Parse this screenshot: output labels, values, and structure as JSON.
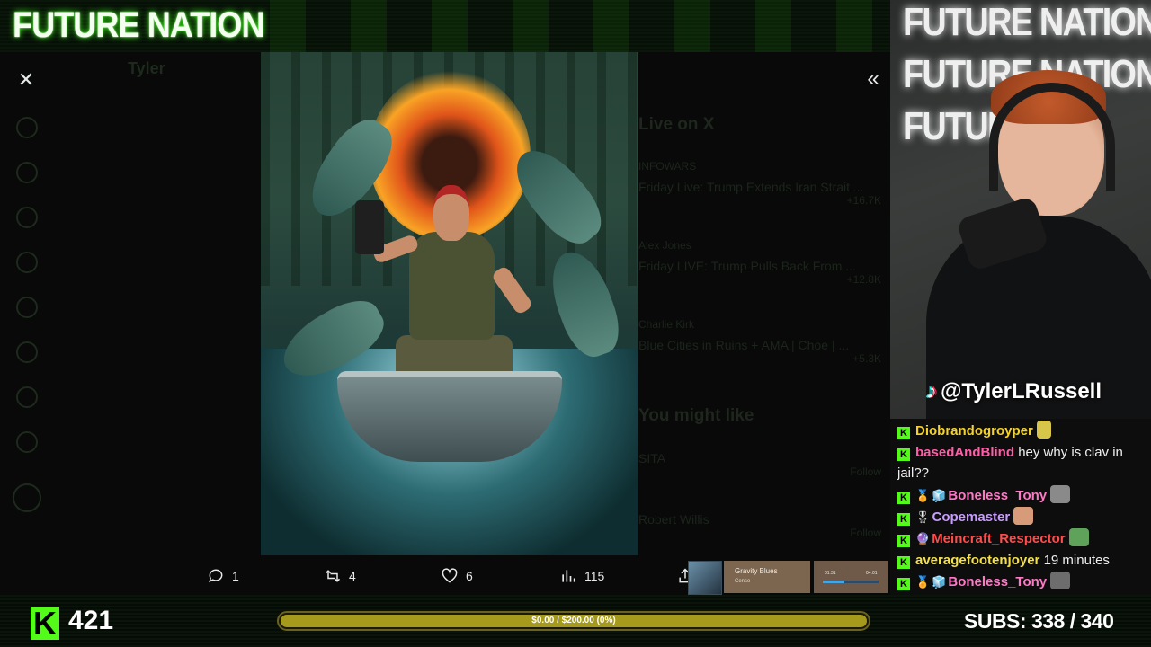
{
  "brand": {
    "title": "FUTURE NATION"
  },
  "viewer": {
    "dim_header": "Tyler",
    "dim_right_title": "Live on X",
    "dim_live_rows": [
      {
        "author": "INFOWARS",
        "title": "Friday Live: Trump Extends Iran Strait ...",
        "count": "+16.7K"
      },
      {
        "author": "Alex Jones",
        "title": "Friday LIVE: Trump Pulls Back From ...",
        "count": "+12.8K"
      },
      {
        "author": "Charlie Kirk",
        "title": "Blue Cities in Ruins + AMA | Choe | ...",
        "count": "+5.3K"
      }
    ],
    "dim_might_like": "You might like",
    "dim_suggestions": [
      {
        "name": "SITA",
        "action": "Follow"
      },
      {
        "name": "Robert Willis",
        "action": "Follow"
      }
    ],
    "actions": {
      "replies": "1",
      "reposts": "4",
      "likes": "6",
      "views": "115"
    }
  },
  "music": {
    "title": "Gravity Blues",
    "artist": "Cense",
    "time_elapsed": "01:31",
    "time_total": "04:01",
    "progress": 0.38
  },
  "cam": {
    "overlay_lines": [
      "FUTURE NATION",
      "FUTURE NATION",
      "FUTURE"
    ],
    "handle": "@TylerLRussell"
  },
  "chat": {
    "messages": [
      {
        "user": "Diobrandogroyper",
        "color": "#f5d22b",
        "text": ""
      },
      {
        "user": "basedAndBlind",
        "color": "#ff5fa8",
        "text": "hey why is clav in jail??"
      },
      {
        "user": "Boneless_Tony",
        "color": "#ff79c6",
        "text": ""
      },
      {
        "user": "Copemaster",
        "color": "#c89bff",
        "text": ""
      },
      {
        "user": "Meincraft_Respector",
        "color": "#ff4d4d",
        "text": ""
      },
      {
        "user": "averagefootenjoyer",
        "color": "#f5e04a",
        "text": "19 minutes"
      },
      {
        "user": "Boneless_Tony",
        "color": "#ff79c6",
        "text": ""
      }
    ]
  },
  "bottom": {
    "viewer_count": "421",
    "goal_text": "$0.00 / $200.00 (0%)",
    "goal_fraction": 0.0,
    "subs_label": "SUBS:",
    "subs_value": "338 / 340"
  },
  "colors": {
    "kick_green": "#53fc18",
    "goal_bar": "#a59a1c",
    "x_text": "#e7e9ea"
  }
}
